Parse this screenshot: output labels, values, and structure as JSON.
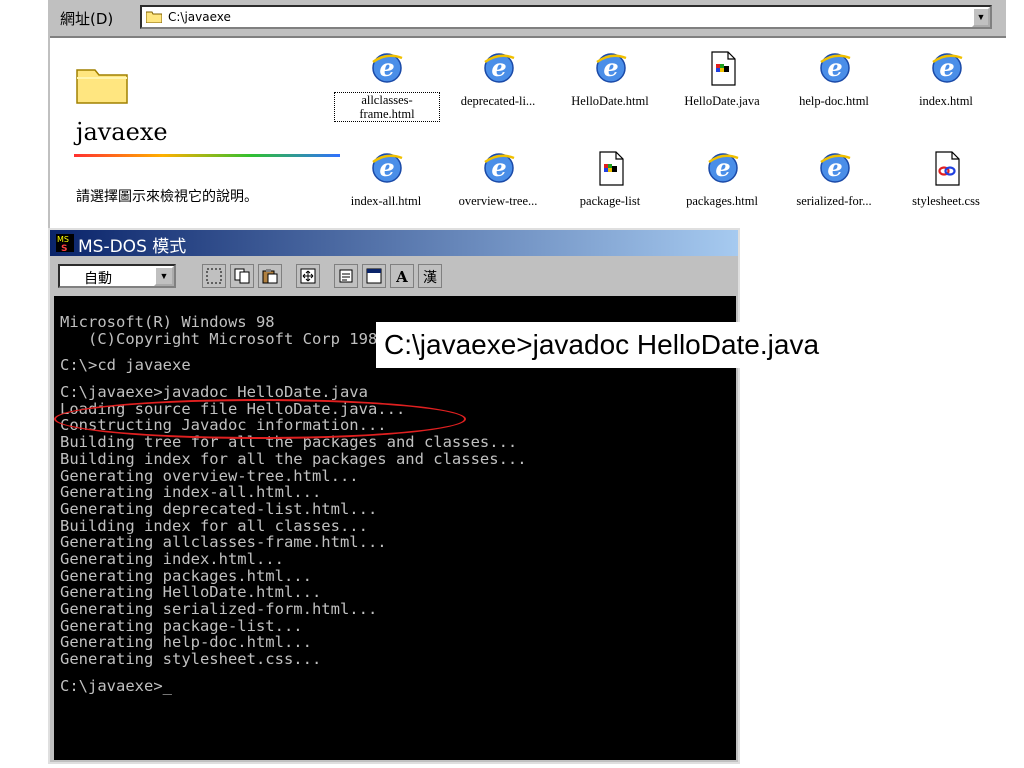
{
  "explorer": {
    "address_label": "網址(D)",
    "address_path": "C:\\javaexe",
    "folder_name": "javaexe",
    "panel_hint": "請選擇圖示來檢視它的說明。",
    "files": [
      {
        "label": "allclasses-frame.html",
        "icon": "ie-html-icon",
        "selected": true
      },
      {
        "label": "deprecated-li...",
        "icon": "ie-html-icon"
      },
      {
        "label": "HelloDate.html",
        "icon": "ie-html-icon"
      },
      {
        "label": "HelloDate.java",
        "icon": "java-file-icon"
      },
      {
        "label": "help-doc.html",
        "icon": "ie-html-icon"
      },
      {
        "label": "index.html",
        "icon": "ie-html-icon"
      },
      {
        "label": "index-all.html",
        "icon": "ie-html-icon"
      },
      {
        "label": "overview-tree...",
        "icon": "ie-html-icon"
      },
      {
        "label": "package-list",
        "icon": "java-file-icon"
      },
      {
        "label": "packages.html",
        "icon": "ie-html-icon"
      },
      {
        "label": "serialized-for...",
        "icon": "ie-html-icon"
      },
      {
        "label": "stylesheet.css",
        "icon": "css-file-icon"
      }
    ]
  },
  "dos": {
    "title": "MS-DOS 模式",
    "font_select": "自動",
    "toolbar_char": "漢",
    "toolbar_a": "A",
    "lines": [
      "Microsoft(R) Windows 98",
      "   (C)Copyright Microsoft Corp 1981-1999.",
      "",
      "C:\\>cd javaexe",
      "",
      "C:\\javaexe>javadoc HelloDate.java",
      "Loading source file HelloDate.java...",
      "Constructing Javadoc information...",
      "Building tree for all the packages and classes...",
      "Building index for all the packages and classes...",
      "Generating overview-tree.html...",
      "Generating index-all.html...",
      "Generating deprecated-list.html...",
      "Building index for all classes...",
      "Generating allclasses-frame.html...",
      "Generating index.html...",
      "Generating packages.html...",
      "Generating HelloDate.html...",
      "Generating serialized-form.html...",
      "Generating package-list...",
      "Generating help-doc.html...",
      "Generating stylesheet.css...",
      "",
      "C:\\javaexe>_"
    ]
  },
  "callout": {
    "text": "C:\\javaexe>javadoc HelloDate.java"
  },
  "colors": {
    "title_bar": "#0a246a",
    "console_bg": "#000000",
    "console_text": "#c0c0c0",
    "highlight_ellipse": "#e02020"
  }
}
